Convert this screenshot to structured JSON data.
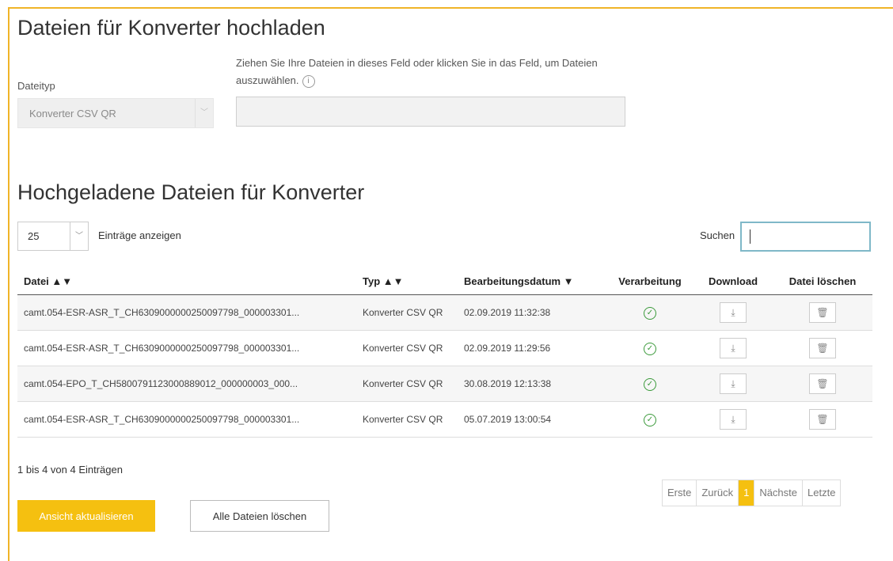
{
  "upload": {
    "title": "Dateien für Konverter hochladen",
    "filetype_label": "Dateityp",
    "filetype_value": "Konverter CSV QR",
    "dropzone_text_1": "Ziehen Sie Ihre Dateien in dieses Feld oder klicken Sie in das Feld, um Dateien",
    "dropzone_text_2": "auszuwählen.",
    "info_icon": "ⓘ"
  },
  "list": {
    "title": "Hochgeladene Dateien für Konverter",
    "entries_value": "25",
    "entries_label": "Einträge anzeigen",
    "search_label": "Suchen",
    "columns": {
      "file": "Datei ▲▼",
      "type": "Typ ▲▼",
      "date": "Bearbeitungsdatum ▼",
      "processing": "Verarbeitung",
      "download": "Download",
      "delete": "Datei löschen"
    },
    "rows": [
      {
        "file": "camt.054-ESR-ASR_T_CH6309000000250097798_000003301...",
        "type": "Konverter CSV QR",
        "date": "02.09.2019 11:32:38"
      },
      {
        "file": "camt.054-ESR-ASR_T_CH6309000000250097798_000003301...",
        "type": "Konverter CSV QR",
        "date": "02.09.2019 11:29:56"
      },
      {
        "file": "camt.054-EPO_T_CH5800791123000889012_000000003_000...",
        "type": "Konverter CSV QR",
        "date": "30.08.2019 12:13:38"
      },
      {
        "file": "camt.054-ESR-ASR_T_CH6309000000250097798_000003301...",
        "type": "Konverter CSV QR",
        "date": "05.07.2019 13:00:54"
      }
    ],
    "info": "1 bis 4 von 4 Einträgen",
    "pager": {
      "first": "Erste",
      "prev": "Zurück",
      "current": "1",
      "next": "Nächste",
      "last": "Letzte"
    }
  },
  "actions": {
    "refresh": "Ansicht aktualisieren",
    "delete_all": "Alle Dateien löschen"
  },
  "colors": {
    "accent": "#f5c010",
    "border_accent": "#f0b428",
    "success": "#3b9a3b"
  }
}
